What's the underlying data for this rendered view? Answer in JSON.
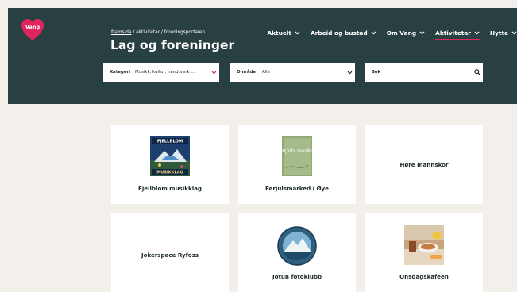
{
  "logo": {
    "text": "Vang",
    "color": "#e0245e"
  },
  "nav": {
    "items": [
      {
        "label": "Aktuelt",
        "active": false
      },
      {
        "label": "Arbeid og bustad",
        "active": false
      },
      {
        "label": "Om Vang",
        "active": false
      },
      {
        "label": "Aktivitetar",
        "active": true
      },
      {
        "label": "Hytte",
        "active": false
      }
    ]
  },
  "breadcrumb": {
    "home": "framsida",
    "separator": " / ",
    "level2": "aktivitetar",
    "current": "foreningsportalen"
  },
  "page": {
    "title": "Lag og foreninger"
  },
  "filters": {
    "kategori": {
      "label": "Kategori",
      "value": "Musikk, kultur, handtverk ..."
    },
    "omrade": {
      "label": "Område",
      "value": "Alle"
    },
    "sok": {
      "label": "Søk",
      "placeholder": ""
    }
  },
  "cards": [
    {
      "title": "Fjellblom musikklag",
      "logo_text_top": "FJELLBLOM",
      "logo_text_bottom": "MUSIKKLAG"
    },
    {
      "title": "Førjulsmarked i Øye",
      "logo_text": "Førjuls marked"
    },
    {
      "title": "Høre mannskor"
    },
    {
      "title": "Jokerspace Ryfoss"
    },
    {
      "title": "Jotun fotoklubb"
    },
    {
      "title": "Onsdagskafeen"
    }
  ],
  "colors": {
    "header_bg": "#294043",
    "page_bg": "#f3f0eb",
    "accent": "#e0245e"
  }
}
